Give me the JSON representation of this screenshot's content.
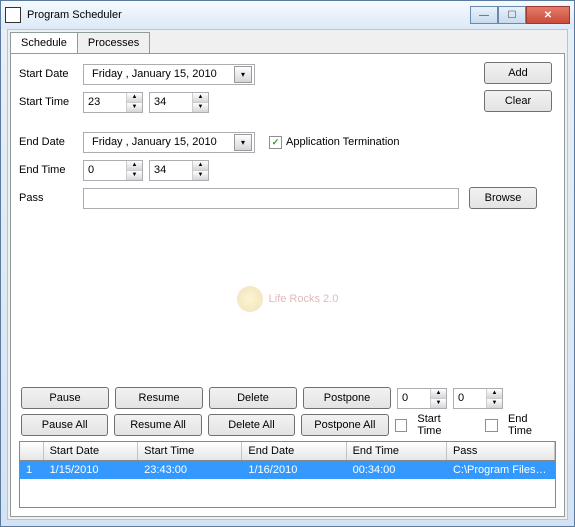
{
  "window": {
    "title": "Program Scheduler"
  },
  "tabs": {
    "schedule": "Schedule",
    "processes": "Processes"
  },
  "form": {
    "start_date_label": "Start Date",
    "start_date_value": "Friday   ,  January   15, 2010",
    "start_time_label": "Start Time",
    "start_time_h": "23",
    "start_time_m": "34",
    "end_date_label": "End Date",
    "end_date_value": "Friday   ,  January   15, 2010",
    "end_time_label": "End Time",
    "end_time_h": "0",
    "end_time_m": "34",
    "app_term_label": "Application Termination",
    "app_term_checked": "✓",
    "pass_label": "Pass",
    "pass_value": ""
  },
  "side_buttons": {
    "add": "Add",
    "clear": "Clear",
    "browse": "Browse"
  },
  "toolbar": {
    "pause": "Pause",
    "resume": "Resume",
    "delete": "Delete",
    "postpone": "Postpone",
    "pause_all": "Pause All",
    "resume_all": "Resume All",
    "delete_all": "Delete All",
    "postpone_all": "Postpone All",
    "num1": "0",
    "num2": "0",
    "start_time_chk": "Start Time",
    "end_time_chk": "End Time"
  },
  "watermark": "Life Rocks 2.0",
  "grid": {
    "headers": {
      "idx": "",
      "start_date": "Start Date",
      "start_time": "Start Time",
      "end_date": "End Date",
      "end_time": "End Time",
      "pass": "Pass"
    },
    "row": {
      "idx": "1",
      "start_date": "1/15/2010",
      "start_time": "23:43:00",
      "end_date": "1/16/2010",
      "end_time": "00:34:00",
      "pass": "C:\\Program Files\\Da..."
    }
  }
}
